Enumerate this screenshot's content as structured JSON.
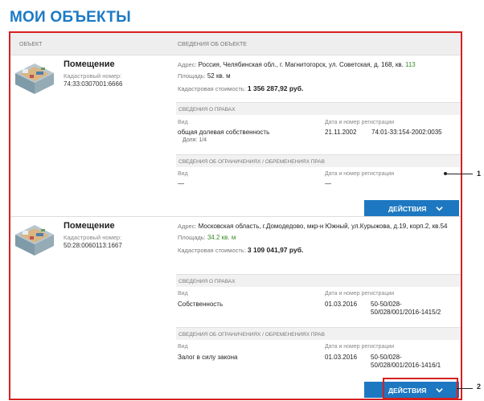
{
  "page": {
    "title": "МОИ ОБЪЕКТЫ"
  },
  "table_header": {
    "col_object": "ОБЪЕКТ",
    "col_info": "СВЕДЕНИЯ ОБ ОБЪЕКТЕ"
  },
  "objects": [
    {
      "type": "Помещение",
      "cad_label": "Кадастровый номер:",
      "cad_number": "74:33:0307001:6666",
      "address_label": "Адрес:",
      "address_text": "Россия, Челябинская обл., г. Магнитогорск, ул. Советская, д. 168, кв.",
      "address_apt": "113",
      "area_label": "Площадь:",
      "area_value": "52 кв. м",
      "cost_label": "Кадастровая стоимость:",
      "cost_value": "1 356 287,92 руб.",
      "rights_header": "СВЕДЕНИЯ О ПРАВАХ",
      "rights_kind_label": "Вид",
      "rights_reg_label": "Дата и номер регистрации",
      "rights_kind": "общая долевая собственность",
      "rights_share": "Доля: 1/4",
      "rights_date": "21.11.2002",
      "rights_number": "74:01-33:154-2002:0035",
      "restr_header": "СВЕДЕНИЯ ОБ ОГРАНИЧЕНИЯХ / ОБРЕМЕНЕНИЯХ ПРАВ",
      "restr_kind_label": "Вид",
      "restr_reg_label": "Дата и номер регистрации",
      "restr_kind": "—",
      "restr_reg": "—",
      "actions_label": "ДЕЙСТВИЯ"
    },
    {
      "type": "Помещение",
      "cad_label": "Кадастровый номер:",
      "cad_number": "50:28:0060113:1667",
      "address_label": "Адрес:",
      "address_text": "Московская область, г.Домодедово, мкр-н Южный, ул.Курыжова, д.19, корп.2, кв.54",
      "area_label": "Площадь:",
      "area_value": "34.2 кв. м",
      "cost_label": "Кадастровая стоимость:",
      "cost_value": "3 109 041,97 руб.",
      "rights_header": "СВЕДЕНИЯ О ПРАВАХ",
      "rights_kind_label": "Вид",
      "rights_reg_label": "Дата и номер регистрации",
      "rights_kind": "Собственность",
      "rights_date": "01.03.2016",
      "rights_number_1": "50-50/028-",
      "rights_number_2": "50/028/001/2016-1415/2",
      "restr_header": "СВЕДЕНИЯ ОБ ОГРАНИЧЕНИЯХ / ОБРЕМЕНЕНИЯХ ПРАВ",
      "restr_kind_label": "Вид",
      "restr_reg_label": "Дата и номер регистрации",
      "restr_kind": "Залог в силу закона",
      "restr_date": "01.03.2016",
      "restr_number_1": "50-50/028-",
      "restr_number_2": "50/028/001/2016-1416/1",
      "actions_label": "ДЕЙСТВИЯ"
    }
  ],
  "callouts": {
    "first": "1",
    "second": "2"
  },
  "colors": {
    "accent": "#1d78c1",
    "title": "#1b7ac5",
    "highlight": "#d62020",
    "apt_number": "#3a8c2a"
  },
  "icons": {
    "room": "room-illustration-icon",
    "chevron": "chevron-down-icon"
  }
}
